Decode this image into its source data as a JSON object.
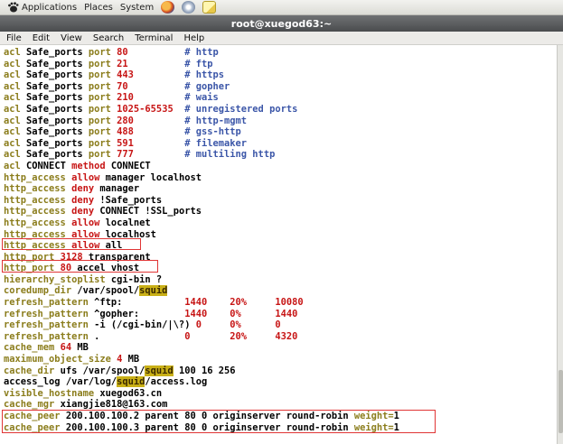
{
  "panel": {
    "applications": "Applications",
    "places": "Places",
    "system": "System"
  },
  "window": {
    "title": "root@xuegod63:~"
  },
  "menu": [
    "File",
    "Edit",
    "View",
    "Search",
    "Terminal",
    "Help"
  ],
  "terminal_lines": [
    [
      [
        "kw",
        "acl"
      ],
      [
        "t",
        " Safe_ports "
      ],
      [
        "kw",
        "port"
      ],
      [
        "red",
        " 80"
      ],
      [
        "t",
        "          "
      ],
      [
        "cm",
        "# http"
      ]
    ],
    [
      [
        "kw",
        "acl"
      ],
      [
        "t",
        " Safe_ports "
      ],
      [
        "kw",
        "port"
      ],
      [
        "red",
        " 21"
      ],
      [
        "t",
        "          "
      ],
      [
        "cm",
        "# ftp"
      ]
    ],
    [
      [
        "kw",
        "acl"
      ],
      [
        "t",
        " Safe_ports "
      ],
      [
        "kw",
        "port"
      ],
      [
        "red",
        " 443"
      ],
      [
        "t",
        "         "
      ],
      [
        "cm",
        "# https"
      ]
    ],
    [
      [
        "kw",
        "acl"
      ],
      [
        "t",
        " Safe_ports "
      ],
      [
        "kw",
        "port"
      ],
      [
        "red",
        " 70"
      ],
      [
        "t",
        "          "
      ],
      [
        "cm",
        "# gopher"
      ]
    ],
    [
      [
        "kw",
        "acl"
      ],
      [
        "t",
        " Safe_ports "
      ],
      [
        "kw",
        "port"
      ],
      [
        "red",
        " 210"
      ],
      [
        "t",
        "         "
      ],
      [
        "cm",
        "# wais"
      ]
    ],
    [
      [
        "kw",
        "acl"
      ],
      [
        "t",
        " Safe_ports "
      ],
      [
        "kw",
        "port"
      ],
      [
        "red",
        " 1025-65535"
      ],
      [
        "t",
        "  "
      ],
      [
        "cm",
        "# unregistered ports"
      ]
    ],
    [
      [
        "kw",
        "acl"
      ],
      [
        "t",
        " Safe_ports "
      ],
      [
        "kw",
        "port"
      ],
      [
        "red",
        " 280"
      ],
      [
        "t",
        "         "
      ],
      [
        "cm",
        "# http-mgmt"
      ]
    ],
    [
      [
        "kw",
        "acl"
      ],
      [
        "t",
        " Safe_ports "
      ],
      [
        "kw",
        "port"
      ],
      [
        "red",
        " 488"
      ],
      [
        "t",
        "         "
      ],
      [
        "cm",
        "# gss-http"
      ]
    ],
    [
      [
        "kw",
        "acl"
      ],
      [
        "t",
        " Safe_ports "
      ],
      [
        "kw",
        "port"
      ],
      [
        "red",
        " 591"
      ],
      [
        "t",
        "         "
      ],
      [
        "cm",
        "# filemaker"
      ]
    ],
    [
      [
        "kw",
        "acl"
      ],
      [
        "t",
        " Safe_ports "
      ],
      [
        "kw",
        "port"
      ],
      [
        "red",
        " 777"
      ],
      [
        "t",
        "         "
      ],
      [
        "cm",
        "# multiling http"
      ]
    ],
    [
      [
        "kw",
        "acl"
      ],
      [
        "t",
        " CONNECT "
      ],
      [
        "red",
        "method"
      ],
      [
        "t",
        " CONNECT"
      ]
    ],
    [
      [
        "kw",
        "http_access"
      ],
      [
        "red",
        " allow"
      ],
      [
        "t",
        " manager localhost"
      ]
    ],
    [
      [
        "kw",
        "http_access"
      ],
      [
        "red",
        " deny"
      ],
      [
        "t",
        " manager"
      ]
    ],
    [
      [
        "kw",
        "http_access"
      ],
      [
        "red",
        " deny"
      ],
      [
        "t",
        " !Safe_ports"
      ]
    ],
    [
      [
        "kw",
        "http_access"
      ],
      [
        "red",
        " deny"
      ],
      [
        "t",
        " CONNECT !SSL_ports"
      ]
    ],
    [
      [
        "kw",
        "http_access"
      ],
      [
        "red",
        " allow"
      ],
      [
        "t",
        " localnet"
      ]
    ],
    [
      [
        "kw",
        "http_access"
      ],
      [
        "red",
        " allow"
      ],
      [
        "t",
        " localhost"
      ]
    ],
    [
      [
        "kw",
        "http_access"
      ],
      [
        "red",
        " allow"
      ],
      [
        "t",
        " all"
      ]
    ],
    [
      [
        "kw",
        "http_port"
      ],
      [
        "red",
        " 3128"
      ],
      [
        "t",
        " transparent"
      ]
    ],
    [
      [
        "kw",
        "http_port"
      ],
      [
        "red",
        " 80"
      ],
      [
        "t",
        " accel vhost"
      ]
    ],
    [
      [
        "kw",
        "hierarchy_stoplist"
      ],
      [
        "t",
        " cgi-bin ?"
      ]
    ],
    [
      [
        "kw",
        "coredump_dir"
      ],
      [
        "t",
        " /var/spool/"
      ],
      [
        "hl",
        "squid"
      ]
    ],
    [
      [
        "kw",
        "refresh_pattern"
      ],
      [
        "t",
        " ^ftp:           "
      ],
      [
        "red",
        "1440"
      ],
      [
        "t",
        "    "
      ],
      [
        "red",
        "20%"
      ],
      [
        "t",
        "     "
      ],
      [
        "red",
        "10080"
      ]
    ],
    [
      [
        "kw",
        "refresh_pattern"
      ],
      [
        "t",
        " ^gopher:        "
      ],
      [
        "red",
        "1440"
      ],
      [
        "t",
        "    "
      ],
      [
        "red",
        "0%"
      ],
      [
        "t",
        "      "
      ],
      [
        "red",
        "1440"
      ]
    ],
    [
      [
        "kw",
        "refresh_pattern"
      ],
      [
        "t",
        " -i (/cgi-bin/|\\?) "
      ],
      [
        "red",
        "0"
      ],
      [
        "t",
        "     "
      ],
      [
        "red",
        "0%"
      ],
      [
        "t",
        "      "
      ],
      [
        "red",
        "0"
      ]
    ],
    [
      [
        "kw",
        "refresh_pattern"
      ],
      [
        "t",
        " .               "
      ],
      [
        "red",
        "0"
      ],
      [
        "t",
        "       "
      ],
      [
        "red",
        "20%"
      ],
      [
        "t",
        "     "
      ],
      [
        "red",
        "4320"
      ]
    ],
    [
      [
        "kw",
        "cache_mem"
      ],
      [
        "red",
        " 64"
      ],
      [
        "t",
        " MB"
      ]
    ],
    [
      [
        "kw",
        "maximum_object_size"
      ],
      [
        "red",
        " 4"
      ],
      [
        "t",
        " MB"
      ]
    ],
    [
      [
        "kw",
        "cache_dir"
      ],
      [
        "t",
        " ufs /var/spool/"
      ],
      [
        "hl",
        "squid"
      ],
      [
        "t",
        " 100 16 256"
      ]
    ],
    [
      [
        "t",
        "access_log /var/log/"
      ],
      [
        "hl",
        "squid"
      ],
      [
        "t",
        "/access.log"
      ]
    ],
    [
      [
        "kw",
        "visible_hostname"
      ],
      [
        "t",
        " xuegod63.cn"
      ]
    ],
    [
      [
        "kw",
        "cache_mgr"
      ],
      [
        "t",
        " xiangjie818@163.com"
      ]
    ],
    [
      [
        "kw",
        "cache_peer"
      ],
      [
        "t",
        " 200.100.100.2 parent 80 0 originserver round-robin "
      ],
      [
        "kw",
        "weight="
      ],
      [
        "t",
        "1"
      ]
    ],
    [
      [
        "kw",
        "cache_peer"
      ],
      [
        "t",
        " 200.100.100.3 parent 80 0 originserver round-robin "
      ],
      [
        "kw",
        "weight="
      ],
      [
        "t",
        "1"
      ]
    ]
  ]
}
